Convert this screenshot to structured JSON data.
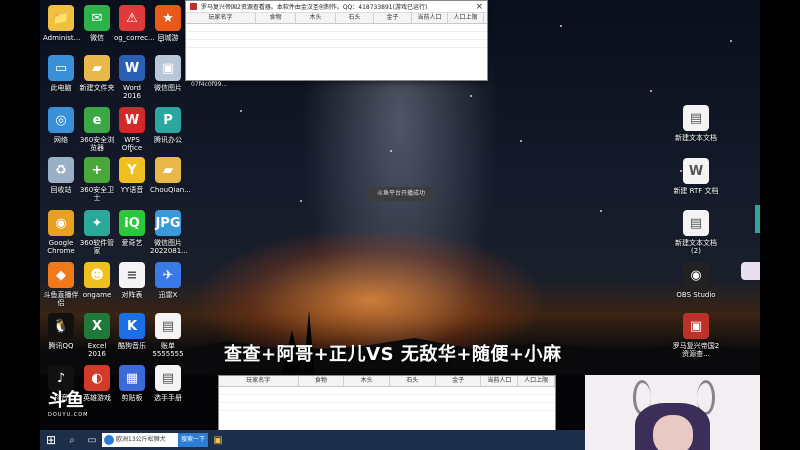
{
  "desktop_icons_left": [
    {
      "name": "administrator-icon",
      "label": "Administ...",
      "color": "#f0c040",
      "glyph": "📁"
    },
    {
      "name": "wechat-icon",
      "label": "微信",
      "color": "#2bb34a",
      "glyph": "✉"
    },
    {
      "name": "og-correct-icon",
      "label": "og_correc...",
      "color": "#e03a3a",
      "glyph": "⚠"
    },
    {
      "name": "recycle-icon",
      "label": "回城游",
      "color": "#e85a1a",
      "glyph": "★"
    },
    {
      "name": "this-pc-icon",
      "label": "此电脑",
      "color": "#3a8fd9",
      "glyph": "▭"
    },
    {
      "name": "new-folder-icon",
      "label": "新建文件夹",
      "color": "#e8b84a",
      "glyph": "▰"
    },
    {
      "name": "word-icon",
      "label": "Word 2016",
      "color": "#2b5fb3",
      "glyph": "W"
    },
    {
      "name": "screenshot-tool-icon",
      "label": "微信图片",
      "color": "#b8c8d8",
      "glyph": "▣"
    },
    {
      "name": "network-icon",
      "label": "网络",
      "color": "#3a8fd9",
      "glyph": "◎"
    },
    {
      "name": "360-browser-icon",
      "label": "360安全浏览器",
      "color": "#3aa845",
      "glyph": "e"
    },
    {
      "name": "wps-icon",
      "label": "WPS Office",
      "color": "#d22a2a",
      "glyph": "W"
    },
    {
      "name": "office-icon",
      "label": "腾讯办公",
      "color": "#2aa8a0",
      "glyph": "P"
    },
    {
      "name": "recycle-bin-icon",
      "label": "回收站",
      "color": "#9ab0c4",
      "glyph": "♻"
    },
    {
      "name": "360-safe-icon",
      "label": "360安全卫士",
      "color": "#4aa83a",
      "glyph": "+"
    },
    {
      "name": "yy-icon",
      "label": "YY语音",
      "color": "#f0c020",
      "glyph": "Y"
    },
    {
      "name": "chouqian-icon",
      "label": "ChouQian...",
      "color": "#e8b84a",
      "glyph": "▰"
    },
    {
      "name": "chrome-icon",
      "label": "Google Chrome",
      "color": "#e8a020",
      "glyph": "◉"
    },
    {
      "name": "360-manager-icon",
      "label": "360软件管家",
      "color": "#2aa89a",
      "glyph": "✦"
    },
    {
      "name": "iqiyi-icon",
      "label": "爱奇艺",
      "color": "#2ac83a",
      "glyph": "iQ"
    },
    {
      "name": "jpg-file-icon",
      "label": "微信图片 2022081...",
      "color": "#3a9ad9",
      "glyph": "JPG"
    },
    {
      "name": "douyu-icon",
      "label": "斗鱼直播伴侣",
      "color": "#f07a1a",
      "glyph": "◆"
    },
    {
      "name": "ongame-icon",
      "label": "ongame",
      "color": "#f0c020",
      "glyph": "☻"
    },
    {
      "name": "text-file-icon",
      "label": "对阵表",
      "color": "#f4f4f4",
      "glyph": "≡"
    },
    {
      "name": "xunlei-icon",
      "label": "迅雷X",
      "color": "#3a7ae8",
      "glyph": "✈"
    },
    {
      "name": "qq-icon",
      "label": "腾讯QQ",
      "color": "#111111",
      "glyph": "🐧"
    },
    {
      "name": "excel-icon",
      "label": "Excel 2016",
      "color": "#1f7a3a",
      "glyph": "X"
    },
    {
      "name": "kugou-icon",
      "label": "酷狗音乐",
      "color": "#1a6ee8",
      "glyph": "K"
    },
    {
      "name": "sheet-file-icon",
      "label": "账单 5555555",
      "color": "#f4f4f4",
      "glyph": "▤"
    },
    {
      "name": "tiktok-icon",
      "label": "抖音",
      "color": "#111111",
      "glyph": "♪"
    },
    {
      "name": "game-icon",
      "label": "英雄游戏",
      "color": "#d23a2a",
      "glyph": "◐"
    },
    {
      "name": "clip-icon",
      "label": "剪贴板",
      "color": "#3a6ad9",
      "glyph": "▦"
    },
    {
      "name": "handbook-icon",
      "label": "选手手册",
      "color": "#f4f4f4",
      "glyph": "▤"
    }
  ],
  "desktop_icons_right": [
    {
      "name": "new-text-doc-icon",
      "label": "新建文本文档",
      "color": "#f4f4f4",
      "glyph": "▤"
    },
    {
      "name": "new-rtf-doc-icon",
      "label": "新建 RTF 文档",
      "color": "#f4f4f4",
      "glyph": "W"
    },
    {
      "name": "new-text-doc-2-icon",
      "label": "新建文本文档 (2)",
      "color": "#f4f4f4",
      "glyph": "▤"
    },
    {
      "name": "obs-icon",
      "label": "OBS Studio",
      "color": "#222222",
      "glyph": "◉"
    },
    {
      "name": "red-app-icon",
      "label": "罗马复兴帝国2资源查...",
      "color": "#c0302a",
      "glyph": "▣"
    }
  ],
  "window_top": {
    "title": "罗马复兴帝国2资源查看器。本软件由金汉圣创制作。QQ：418733891(游戏已运行)",
    "columns": [
      "玩家名字",
      "食物",
      "木头",
      "石头",
      "金子",
      "当前人口",
      "人口上限"
    ],
    "side_label": "07f4c0f99..."
  },
  "window_bottom": {
    "columns": [
      "玩家名字",
      "食物",
      "木头",
      "石头",
      "金子",
      "当前人口",
      "人口上限"
    ]
  },
  "center_toast": "斗鱼平台开播成功",
  "overlay_title": "查查+阿哥+正儿VS 无敌华+随便+小麻",
  "douyu_logo": {
    "big": "斗鱼",
    "small": "DOUYU.COM"
  },
  "taskbar": {
    "search_text": "欧洲13公斤松狮犬",
    "search_button": "搜索一下"
  }
}
